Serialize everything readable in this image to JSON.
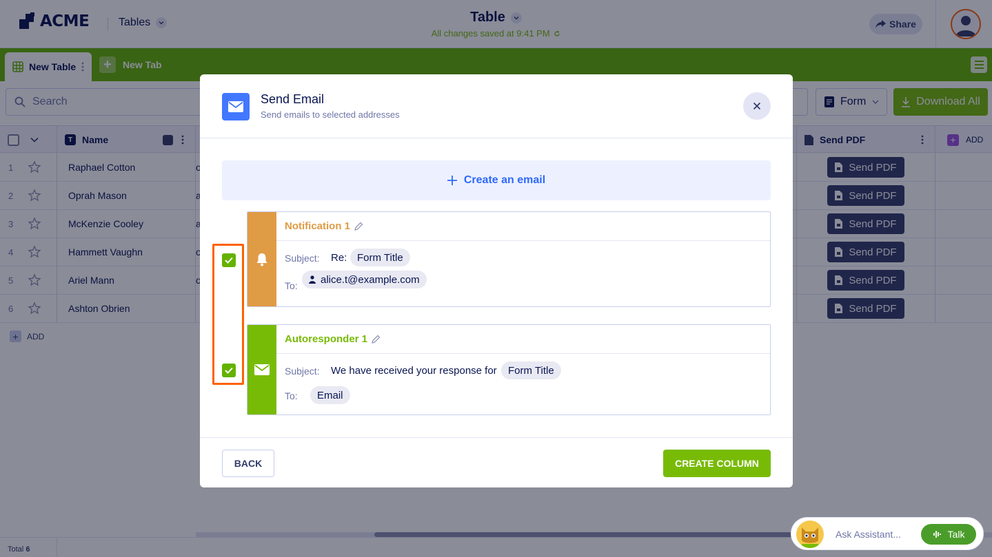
{
  "header": {
    "logo_text": "ACME",
    "tables_menu_label": "Tables",
    "doc_title": "Table",
    "save_status": "All changes saved at 9:41 PM",
    "share_label": "Share"
  },
  "tabs": {
    "active_label": "New Table",
    "new_tab_label": "New Tab"
  },
  "toolbar": {
    "search_placeholder": "Search",
    "form_dropdown_label": "Form",
    "download_label": "Download All"
  },
  "table": {
    "columns": {
      "name": "Name",
      "send_pdf": "Send PDF",
      "add": "ADD"
    },
    "rows": [
      {
        "num": "1",
        "name": "Raphael Cotton",
        "frag": "o",
        "action": "Send PDF"
      },
      {
        "num": "2",
        "name": "Oprah Mason",
        "frag": "a",
        "action": "Send PDF"
      },
      {
        "num": "3",
        "name": "McKenzie Cooley",
        "frag": "a",
        "action": "Send PDF"
      },
      {
        "num": "4",
        "name": "Hammett Vaughn",
        "frag": "o",
        "action": "Send PDF"
      },
      {
        "num": "5",
        "name": "Ariel Mann",
        "frag": "o",
        "action": "Send PDF"
      },
      {
        "num": "6",
        "name": "Ashton Obrien",
        "frag": "",
        "action": "Send PDF"
      }
    ],
    "add_row_label": "ADD"
  },
  "footer": {
    "total_label": "Total",
    "total_count": "6"
  },
  "modal": {
    "title": "Send Email",
    "subtitle": "Send emails to selected addresses",
    "create_email_label": "Create an email",
    "emails": [
      {
        "title": "Notification 1",
        "color": "#e09b45",
        "icon": "bell-icon",
        "checked": true,
        "subject_label": "Subject:",
        "subject_prefix": "Re:",
        "subject_tag": "Form Title",
        "to_label": "To:",
        "to_value": "alice.t@example.com"
      },
      {
        "title": "Autoresponder 1",
        "color": "#78bb07",
        "icon": "envelope-icon",
        "checked": true,
        "subject_label": "Subject:",
        "subject_prefix": "We have received your response for",
        "subject_tag": "Form Title",
        "to_label": "To:",
        "to_value": "Email"
      }
    ],
    "back_label": "BACK",
    "create_label": "CREATE COLUMN"
  },
  "assistant": {
    "placeholder": "Ask Assistant...",
    "talk_label": "Talk"
  }
}
